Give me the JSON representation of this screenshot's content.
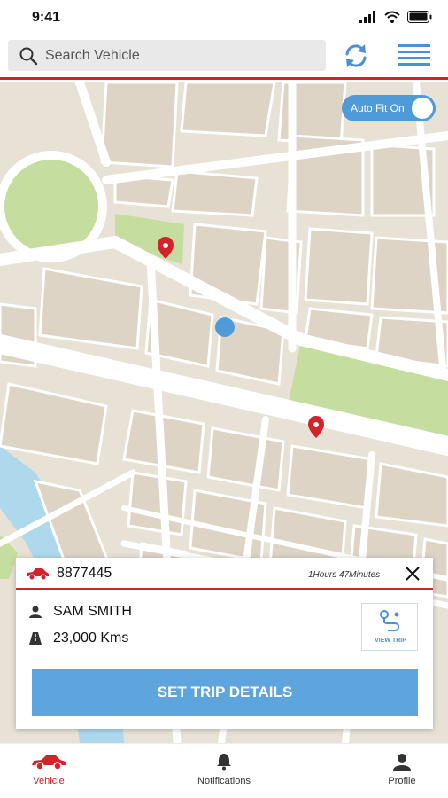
{
  "status_bar": {
    "time": "9:41"
  },
  "search": {
    "placeholder": "Search Vehicle"
  },
  "map": {
    "auto_fit_label": "Auto Fit On",
    "auto_fit_enabled": true
  },
  "vehicle_card": {
    "vehicle_number": "8877445",
    "duration": "1Hours 47Minutes",
    "driver_name": "SAM SMITH",
    "distance": "23,000 Kms",
    "view_trip_label": "VIEW TRIP",
    "set_trip_label": "SET TRIP DETAILS"
  },
  "bottom_nav": {
    "items": [
      {
        "label": "Vehicle",
        "icon": "car-icon",
        "active": true
      },
      {
        "label": "Notifications",
        "icon": "bell-icon",
        "active": false
      },
      {
        "label": "Profile",
        "icon": "person-icon",
        "active": false
      }
    ]
  },
  "colors": {
    "accent": "#d2232a",
    "primary": "#5ea5de",
    "map_park": "#c5dea0",
    "map_water": "#aed8ec"
  }
}
